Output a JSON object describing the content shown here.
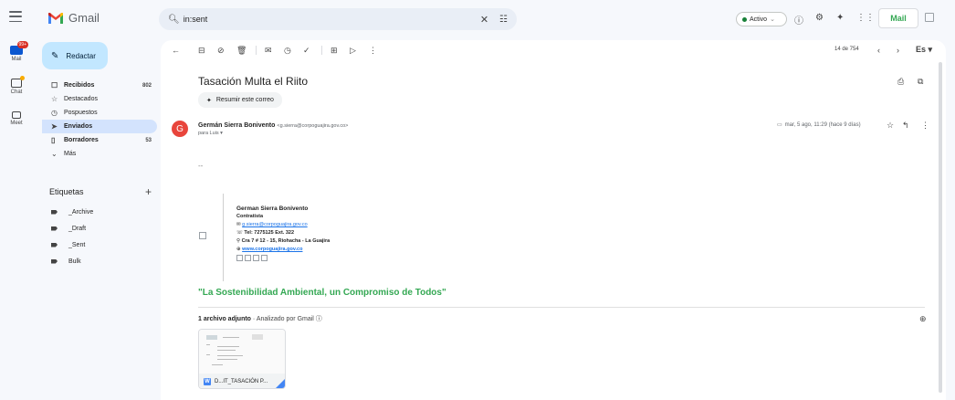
{
  "app": {
    "name": "Gmail"
  },
  "search": {
    "value": "in:sent"
  },
  "status": {
    "label": "Activo"
  },
  "header": {
    "logo_text": "Mail"
  },
  "rail": {
    "mail_label": "Mail",
    "mail_badge": "99+",
    "chat_label": "Chat",
    "meet_label": "Meet"
  },
  "compose": {
    "label": "Redactar"
  },
  "nav": {
    "items": [
      {
        "label": "Recibidos",
        "count": "802"
      },
      {
        "label": "Destacados",
        "count": ""
      },
      {
        "label": "Pospuestos",
        "count": ""
      },
      {
        "label": "Enviados",
        "count": ""
      },
      {
        "label": "Borradores",
        "count": "53"
      },
      {
        "label": "Más",
        "count": ""
      }
    ]
  },
  "labels": {
    "title": "Etiquetas",
    "items": [
      "_Archive",
      "_Draft",
      "_Sent",
      "Bulk"
    ]
  },
  "toolbar": {
    "pager": "14 de 754",
    "lang": "Es"
  },
  "email": {
    "subject": "Tasación Multa el Riito",
    "summarize": "Resumir este correo",
    "avatar_letter": "G",
    "sender_name": "Germán Sierra Bonivento",
    "sender_email": "<g.sierra@corpoguajira.gov.co>",
    "to": "para Luis",
    "date": "mar, 5 ago, 11:29 (hace 9 días)",
    "dash": "--",
    "signature": {
      "name": "German Sierra Bonivento",
      "role": "Contratista",
      "email": "g.sierra@corpoguajira.gov.co",
      "tel": "Tel: 7275125 Ext. 322",
      "address": "Cra 7 # 12 - 15, Riohacha - La Guajira",
      "web": "www.corpoguajira.gov.co"
    },
    "motto": "\"La Sostenibilidad Ambiental, un Compromiso de Todos\""
  },
  "attachment": {
    "count_label": "1 archivo adjunto",
    "scan_label": "Analizado por Gmail",
    "file_name": "D...IT_TASACIÓN P...",
    "type_letter": "W"
  },
  "colors": {
    "accent_blue": "#1a73e8",
    "compose_bg": "#c2e7ff",
    "active_nav": "#d3e3fd",
    "motto_green": "#34a853",
    "avatar_red": "#e8453c"
  }
}
